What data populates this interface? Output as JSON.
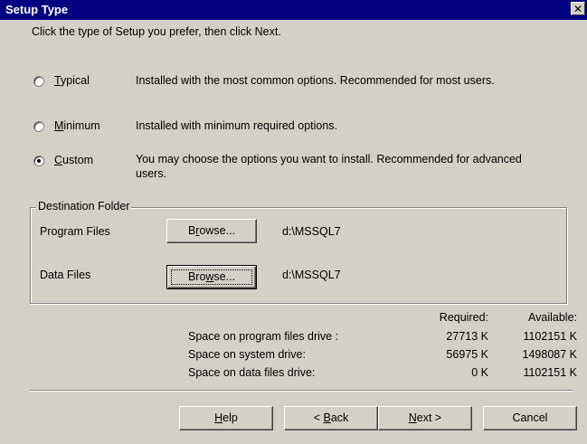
{
  "window": {
    "title": "Setup Type",
    "close_glyph": "✕"
  },
  "instruction": "Click the type of Setup you prefer, then click Next.",
  "options": [
    {
      "label_prefix": "",
      "mnemonic": "T",
      "label_rest": "ypical",
      "description": "Installed with the most common options. Recommended for most users.",
      "selected": false
    },
    {
      "label_prefix": "",
      "mnemonic": "M",
      "label_rest": "inimum",
      "description": "Installed with minimum required options.",
      "selected": false
    },
    {
      "label_prefix": "",
      "mnemonic": "C",
      "label_rest": "ustom",
      "description": "You may choose the options you want to install. Recommended for advanced users.",
      "selected": true
    }
  ],
  "destination": {
    "group_label": "Destination Folder",
    "program_files": {
      "label": "Program Files",
      "browse_pre": "B",
      "browse_mnemonic": "r",
      "browse_post": "owse...",
      "path": "d:\\MSSQL7"
    },
    "data_files": {
      "label": "Data Files",
      "browse_pre": "Bro",
      "browse_mnemonic": "w",
      "browse_post": "se...",
      "path": "d:\\MSSQL7"
    }
  },
  "space": {
    "required_header": "Required:",
    "available_header": "Available:",
    "rows": [
      {
        "label": "Space on program files drive :",
        "required": "27713 K",
        "available": "1102151 K"
      },
      {
        "label": "Space on system drive:",
        "required": "56975 K",
        "available": "1498087 K"
      },
      {
        "label": "Space on data files drive:",
        "required": "0 K",
        "available": "1102151 K"
      }
    ]
  },
  "buttons": {
    "help_mnemonic": "H",
    "help_rest": "elp",
    "back_pre": "< ",
    "back_mnemonic": "B",
    "back_rest": "ack",
    "next_mnemonic": "N",
    "next_rest": "ext >",
    "cancel": "Cancel"
  }
}
